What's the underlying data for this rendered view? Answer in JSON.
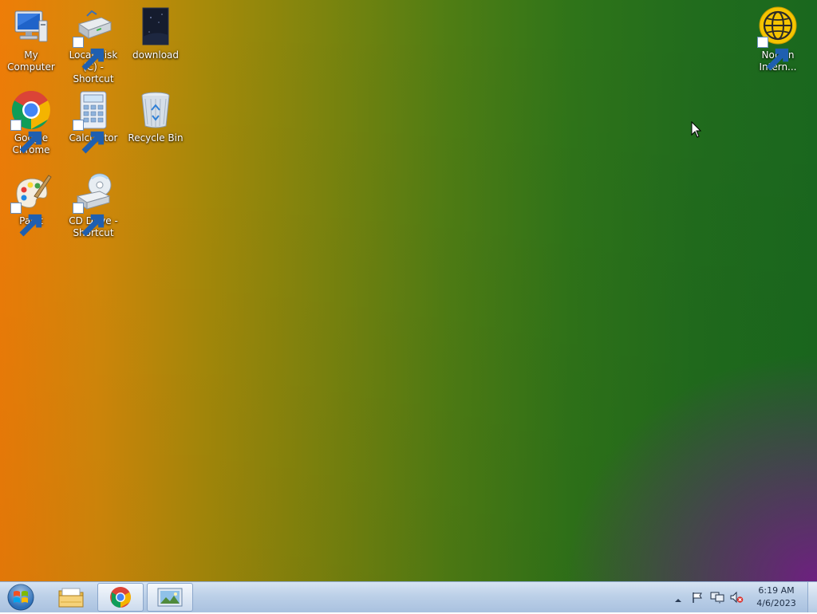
{
  "desktop": {
    "icons": [
      {
        "label": "My Computer",
        "icon": "computer-icon"
      },
      {
        "label": "Local Disk (C) - Shortcut",
        "icon": "hard-disk-icon"
      },
      {
        "label": "download",
        "icon": "image-file-icon"
      },
      {
        "label": "Norton Intern...",
        "icon": "norton-globe-icon"
      },
      {
        "label": "Google Chrome",
        "icon": "chrome-icon"
      },
      {
        "label": "Calculator",
        "icon": "calculator-icon"
      },
      {
        "label": "Recycle Bin",
        "icon": "recycle-bin-icon"
      },
      {
        "label": "Paint",
        "icon": "paint-palette-icon"
      },
      {
        "label": "CD Drive - Shortcut",
        "icon": "cd-drive-icon"
      }
    ]
  },
  "taskbar": {
    "start_icon": "windows-logo-icon",
    "pinned": [
      {
        "name": "Windows Explorer",
        "icon": "folder-icon"
      },
      {
        "name": "Google Chrome",
        "icon": "chrome-icon"
      },
      {
        "name": "Picture Viewer",
        "icon": "image-viewer-icon"
      }
    ],
    "tray": {
      "icons": [
        "show-hidden-icons-icon",
        "action-center-flag-icon",
        "network-icon",
        "volume-muted-icon"
      ],
      "time": "6:19 AM",
      "date": "4/6/2023"
    }
  },
  "colors": {
    "wallpaper_left": "#ee7d08",
    "wallpaper_right": "#1a681e",
    "wallpaper_corner": "#781e8c",
    "taskbar": "#bcd0e8"
  }
}
